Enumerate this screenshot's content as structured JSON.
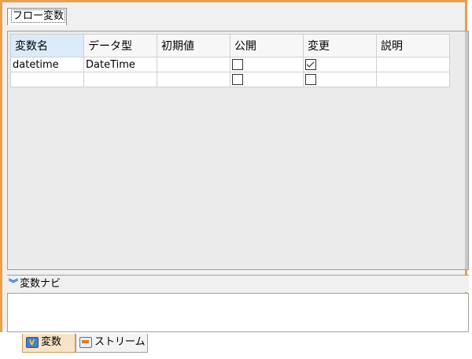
{
  "flow_tab": {
    "label": "フロー変数"
  },
  "table": {
    "headers": [
      "変数名",
      "データ型",
      "初期値",
      "公開",
      "変更",
      "説明"
    ],
    "rows": [
      {
        "name": "datetime",
        "type": "DateTime",
        "initial": "",
        "public": false,
        "modified": true,
        "description": ""
      },
      {
        "name": "",
        "type": "",
        "initial": "",
        "public": false,
        "modified": false,
        "description": ""
      }
    ]
  },
  "navi": {
    "title": "変数ナビ"
  },
  "bottom_tabs": [
    {
      "label": "変数",
      "icon": "variable-icon",
      "active": true
    },
    {
      "label": "ストリーム",
      "icon": "stream-icon",
      "active": false
    }
  ],
  "colors": {
    "frame": "#e9a14a",
    "header_selected": "#dcebfa",
    "tab_active": "#f7e3c7"
  }
}
